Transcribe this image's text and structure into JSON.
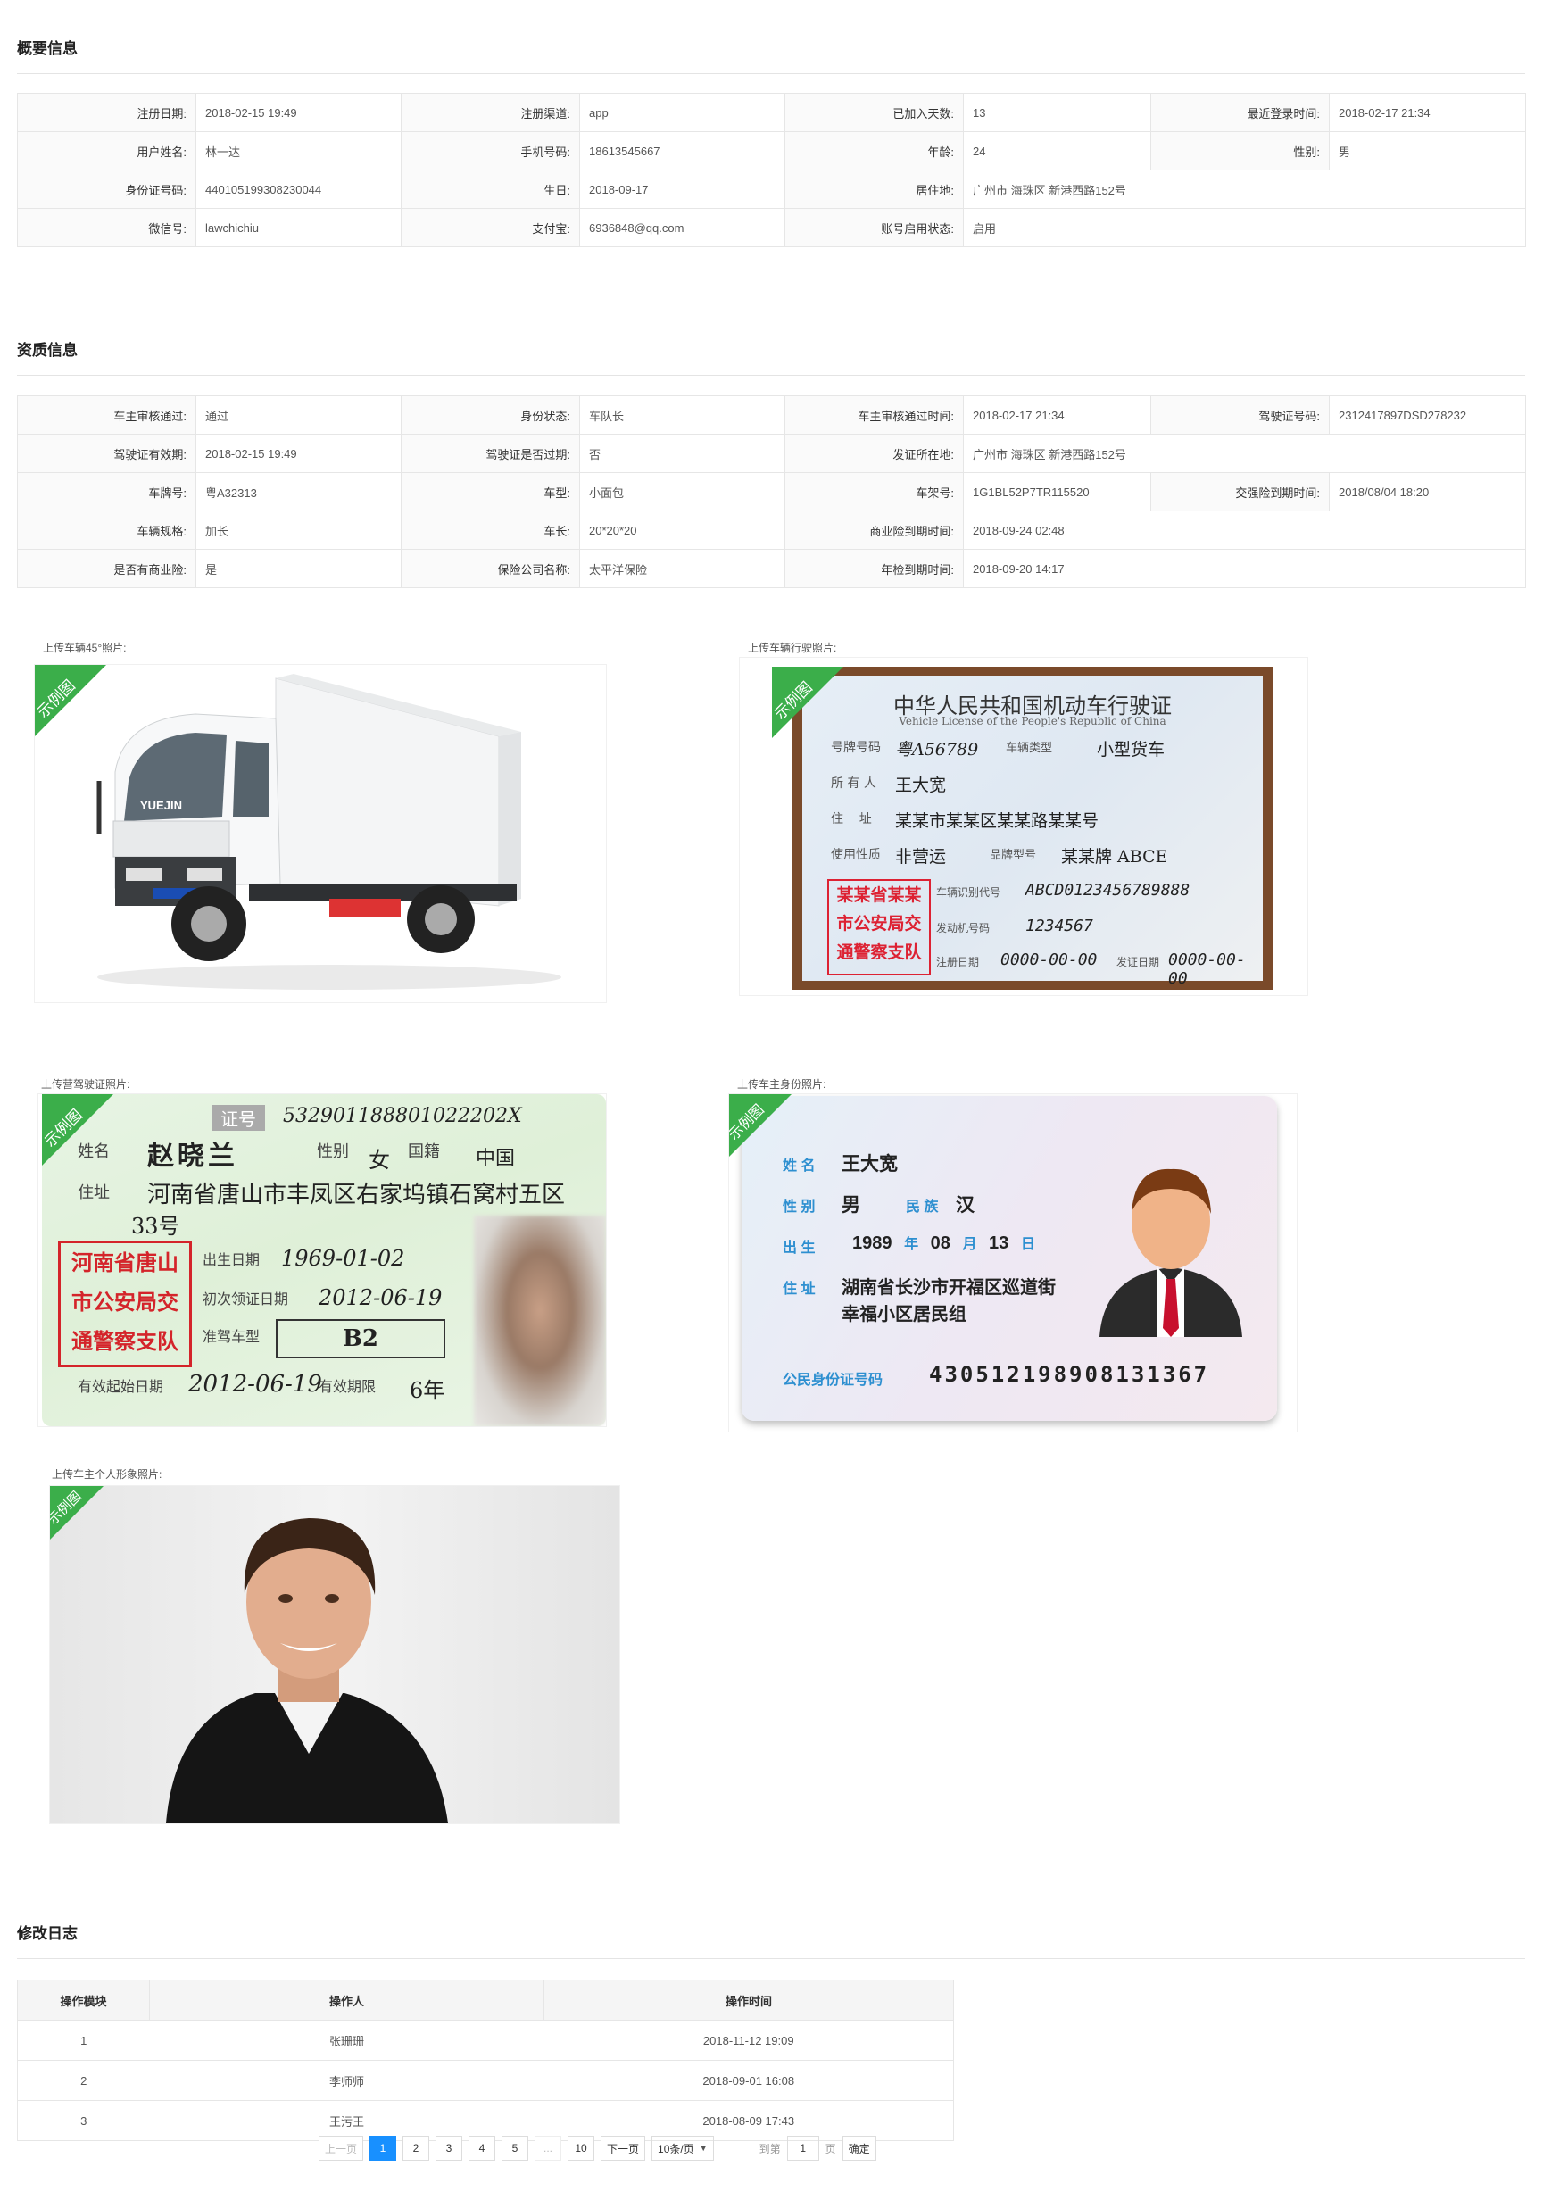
{
  "overview": {
    "title": "概要信息",
    "rows": [
      [
        [
          "注册日期:",
          "2018-02-15   19:49"
        ],
        [
          "注册渠道:",
          "app"
        ],
        [
          "已加入天数:",
          "13"
        ],
        [
          "最近登录时间:",
          "2018-02-17   21:34"
        ]
      ],
      [
        [
          "用户姓名:",
          "林一达"
        ],
        [
          "手机号码:",
          "18613545667"
        ],
        [
          "年龄:",
          "24"
        ],
        [
          "性别:",
          "男"
        ]
      ],
      [
        [
          "身份证号码:",
          "440105199308230044"
        ],
        [
          "生日:",
          "2018-09-17"
        ],
        [
          "居住地:",
          "广州市  海珠区  新港西路152号"
        ]
      ],
      [
        [
          "微信号:",
          "lawchichiu"
        ],
        [
          "支付宝:",
          "6936848@qq.com"
        ],
        [
          "账号启用状态:",
          "启用"
        ]
      ]
    ]
  },
  "qualification": {
    "title": "资质信息",
    "rows": [
      [
        [
          "车主审核通过:",
          "通过"
        ],
        [
          "身份状态:",
          "车队长"
        ],
        [
          "车主审核通过时间:",
          "2018-02-17   21:34"
        ],
        [
          "驾驶证号码:",
          "2312417897DSD278232"
        ]
      ],
      [
        [
          "驾驶证有效期:",
          "2018-02-15   19:49"
        ],
        [
          "驾驶证是否过期:",
          "否"
        ],
        [
          "发证所在地:",
          "广州市  海珠区  新港西路152号"
        ]
      ],
      [
        [
          "车牌号:",
          "粤A32313"
        ],
        [
          "车型:",
          "小面包"
        ],
        [
          "车架号:",
          "1G1BL52P7TR115520"
        ],
        [
          "交强险到期时间:",
          "2018/08/04   18:20"
        ]
      ],
      [
        [
          "车辆规格:",
          "加长"
        ],
        [
          "车长:",
          "20*20*20"
        ],
        [
          "商业险到期时间:",
          "2018-09-24   02:48"
        ]
      ],
      [
        [
          "是否有商业险:",
          "是"
        ],
        [
          "保险公司名称:",
          "太平洋保险"
        ],
        [
          "年检到期时间:",
          "2018-09-20   14:17"
        ]
      ]
    ]
  },
  "photos": {
    "badge": "示例图",
    "truck_label": "上传车辆45°照片:",
    "vehicle_license_label": "上传车辆行驶照片:",
    "driver_license_label": "上传营驾驶证照片:",
    "id_card_label": "上传车主身份照片:",
    "portrait_label": "上传车主个人形象照片:",
    "truck_brand": "YUEJIN",
    "vl": {
      "title": "中华人民共和国机动车行驶证",
      "subtitle": "Vehicle License of the People's Republic of China",
      "plate_lbl": "号牌号码",
      "plate": "粤A56789",
      "type_lbl": "车辆类型",
      "type": "小型货车",
      "owner_lbl": "所 有 人",
      "owner": "王大宽",
      "addr_lbl": "住    址",
      "addr": "某某市某某区某某路某某号",
      "use_lbl": "使用性质",
      "use": "非营运",
      "model_lbl": "品牌型号",
      "model": "某某牌 ABCE",
      "vin_lbl": "车辆识别代号",
      "vin": "ABCD0123456789888",
      "engine_lbl": "发动机号码",
      "engine": "1234567",
      "reg_lbl": "注册日期",
      "reg": "0000-00-00",
      "issue_lbl": "发证日期",
      "issue": "0000-00-00",
      "stamp": [
        "某某省某某",
        "市公安局交",
        "通警察支队"
      ]
    },
    "dl": {
      "no_lbl": "证号",
      "no": "532901188801022202X",
      "name_lbl": "姓名",
      "name": "赵晓兰",
      "sex_lbl": "性别",
      "sex": "女",
      "nation_lbl": "国籍",
      "nation": "中国",
      "addr_lbl": "住址",
      "addr": "河南省唐山市丰凤区右家坞镇石窝村五区",
      "addr2": "33号",
      "birth_lbl": "出生日期",
      "birth": "1969-01-02",
      "issue_lbl": "初次领证日期",
      "issue": "2012-06-19",
      "class_lbl": "准驾车型",
      "class": "B2",
      "from_lbl": "有效起始日期",
      "from": "2012-06-19",
      "valid_lbl": "有效期限",
      "valid": "6年",
      "stamp": [
        "河南省唐山",
        "市公安局交",
        "通警察支队"
      ]
    },
    "idc": {
      "name_lbl": "姓 名",
      "name": "王大宽",
      "sex_lbl": "性 别",
      "sex": "男",
      "eth_lbl": "民 族",
      "eth": "汉",
      "birth_lbl": "出 生",
      "year": "1989",
      "year_u": "年",
      "month": "08",
      "month_u": "月",
      "day": "13",
      "day_u": "日",
      "addr_lbl": "住 址",
      "addr1": "湖南省长沙市开福区巡道街",
      "addr2": "幸福小区居民组",
      "no_lbl": "公民身份证号码",
      "no": "430512198908131367"
    }
  },
  "log": {
    "title": "修改日志",
    "headers": [
      "操作模块",
      "操作人",
      "操作时间"
    ],
    "rows": [
      [
        "1",
        "张珊珊",
        "2018-11-12    19:09"
      ],
      [
        "2",
        "李师师",
        "2018-09-01    16:08"
      ],
      [
        "3",
        "王污王",
        "2018-08-09    17:43"
      ]
    ]
  },
  "pagination": {
    "prev": "上一页",
    "pages": [
      "1",
      "2",
      "3",
      "4",
      "5"
    ],
    "ellipsis": "...",
    "last": "10",
    "next": "下一页",
    "page_size": "10条/页",
    "goto": "到第",
    "goto_value": "1",
    "page_unit": "页",
    "confirm": "确定",
    "active_color": "#1890ff"
  }
}
